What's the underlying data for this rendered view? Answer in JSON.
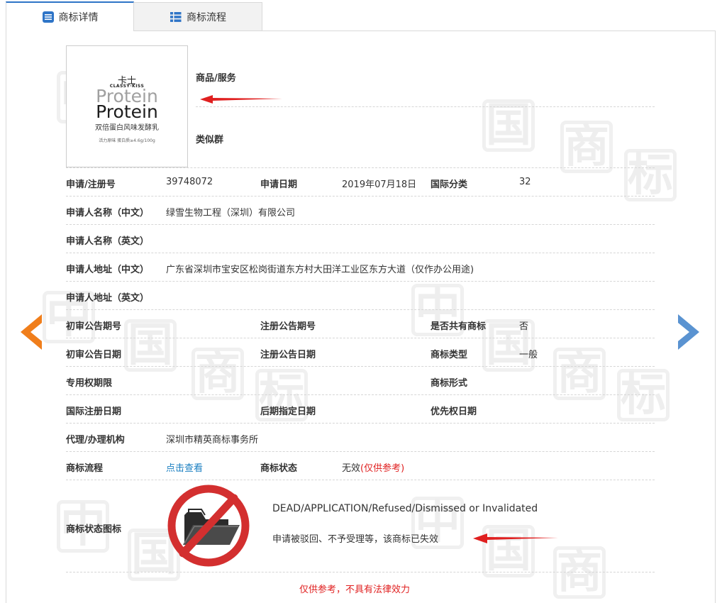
{
  "tabs": [
    {
      "label": "商标详情",
      "active": true
    },
    {
      "label": "商标流程",
      "active": false
    }
  ],
  "watermark_chars": [
    "中",
    "国",
    "商",
    "标"
  ],
  "thumbnail": {
    "brand_cn": "卡士",
    "brand_en": "CLASSY·KISS",
    "word1": "Protein",
    "word2": "Protein",
    "sub": "双倍蛋白风味发酵乳",
    "fine": "活力原味  蛋白质≥4.6g/100g"
  },
  "labels": {
    "goods_services": "商品/服务",
    "similar_group": "类似群",
    "reg_no": "申请/注册号",
    "app_date": "申请日期",
    "intl_class": "国际分类",
    "applicant_cn": "申请人名称（中文）",
    "applicant_en": "申请人名称（英文）",
    "address_cn": "申请人地址（中文）",
    "address_en": "申请人地址（英文）",
    "prelim_no": "初审公告期号",
    "reg_pub_no": "注册公告期号",
    "shared": "是否共有商标",
    "prelim_date": "初审公告日期",
    "reg_pub_date": "注册公告日期",
    "tm_type": "商标类型",
    "exclusive_period": "专用权期限",
    "tm_form": "商标形式",
    "intl_reg_date": "国际注册日期",
    "later_date": "后期指定日期",
    "priority_date": "优先权日期",
    "agent": "代理/办理机构",
    "tm_process": "商标流程",
    "tm_status": "商标状态",
    "status_icon": "商标状态图标"
  },
  "values": {
    "reg_no": "39748072",
    "app_date": "2019年07月18日",
    "intl_class": "32",
    "applicant_cn": "绿雪生物工程（深圳）有限公司",
    "address_cn": "广东省深圳市宝安区松岗街道东方村大田洋工业区东方大道（仅作办公用途)",
    "shared": "否",
    "tm_type": "一般",
    "agent": "深圳市精英商标事务所",
    "process_link": "点击查看",
    "status": "无效",
    "status_note": "(仅供参考)",
    "status_en": "DEAD/APPLICATION/Refused/Dismissed or Invalidated",
    "status_cn": "申请被驳回、不予受理等，该商标已失效",
    "disclaimer": "仅供参考，不具有法律效力"
  },
  "colors": {
    "tab_accent": "#2e74c7",
    "prev_arrow": "#f07e1b",
    "next_arrow": "#5a93d1",
    "annotation_red": "#e02020"
  }
}
